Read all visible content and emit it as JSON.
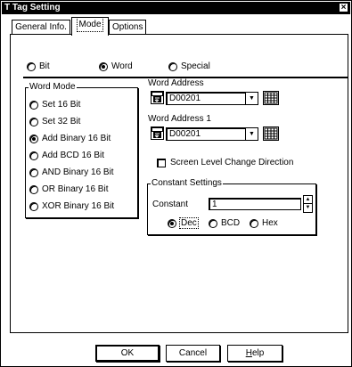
{
  "window": {
    "title": "T Tag Setting",
    "close_glyph": "×"
  },
  "tabs": [
    {
      "label": "General Info."
    },
    {
      "label": "Mode"
    },
    {
      "label": "Options"
    }
  ],
  "tag_type": {
    "options": [
      {
        "label": "Bit",
        "selected": false
      },
      {
        "label": "Word",
        "selected": true
      },
      {
        "label": "Special",
        "selected": false
      }
    ]
  },
  "word_mode": {
    "title": "Word Mode",
    "options": [
      {
        "label": "Set 16 Bit",
        "selected": false
      },
      {
        "label": "Set 32 Bit",
        "selected": false
      },
      {
        "label": "Add Binary 16 Bit",
        "selected": true
      },
      {
        "label": "Add BCD 16 Bit",
        "selected": false
      },
      {
        "label": "AND Binary 16 Bit",
        "selected": false
      },
      {
        "label": "OR Binary 16 Bit",
        "selected": false
      },
      {
        "label": "XOR Binary 16 Bit",
        "selected": false
      }
    ]
  },
  "word_address": {
    "label": "Word Address",
    "value": "D00201"
  },
  "word_address_1": {
    "label": "Word Address 1",
    "value": "D00201"
  },
  "screen_level_change": {
    "label": "Screen Level Change Direction",
    "checked": false
  },
  "constant_settings": {
    "title": "Constant Settings",
    "constant_label": "Constant",
    "constant_value": "1",
    "format_options": [
      {
        "label": "Dec",
        "selected": true
      },
      {
        "label": "BCD",
        "selected": false
      },
      {
        "label": "Hex",
        "selected": false
      }
    ]
  },
  "buttons": {
    "ok": "OK",
    "cancel": "Cancel",
    "help_underlined": "H",
    "help_rest": "elp"
  }
}
